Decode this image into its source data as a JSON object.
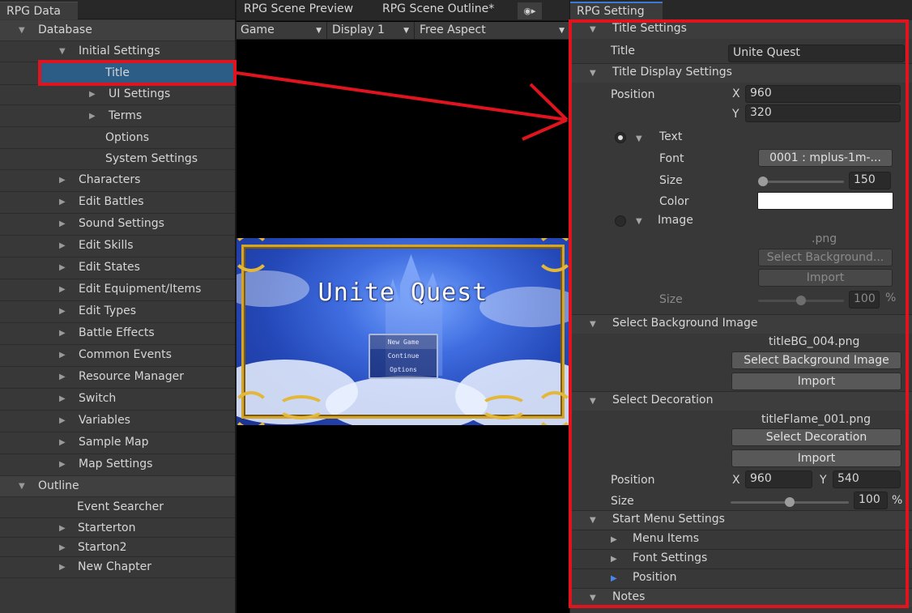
{
  "left_panel": {
    "tab": "RPG Data",
    "tree": [
      {
        "label": "Database",
        "expanded": true,
        "section": true
      },
      {
        "label": "Initial Settings",
        "expanded": true
      },
      {
        "label": "Title",
        "selected": true
      },
      {
        "label": "UI Settings",
        "expandable": true
      },
      {
        "label": "Terms",
        "expandable": true
      },
      {
        "label": "Options"
      },
      {
        "label": "System Settings"
      },
      {
        "label": "Characters",
        "expandable": true
      },
      {
        "label": "Edit Battles",
        "expandable": true
      },
      {
        "label": "Sound Settings",
        "expandable": true
      },
      {
        "label": "Edit Skills",
        "expandable": true
      },
      {
        "label": "Edit States",
        "expandable": true
      },
      {
        "label": "Edit Equipment/Items",
        "expandable": true
      },
      {
        "label": "Edit Types",
        "expandable": true
      },
      {
        "label": "Battle Effects",
        "expandable": true
      },
      {
        "label": "Common Events",
        "expandable": true
      },
      {
        "label": "Resource Manager",
        "expandable": true
      },
      {
        "label": "Switch",
        "expandable": true
      },
      {
        "label": "Variables",
        "expandable": true
      },
      {
        "label": "Sample Map",
        "expandable": true
      },
      {
        "label": "Map Settings",
        "expandable": true
      },
      {
        "label": "Outline",
        "expanded": true,
        "section": true
      },
      {
        "label": "Event Searcher"
      },
      {
        "label": "Starterton",
        "expandable": true
      },
      {
        "label": "Starton2",
        "expandable": true
      },
      {
        "label": "New Chapter",
        "expandable": true
      }
    ]
  },
  "middle_panel": {
    "tabs": [
      "RPG Scene Preview",
      "RPG Scene Outline*"
    ],
    "toolbar": {
      "display_mode": "Game",
      "display": "Display 1",
      "aspect": "Free Aspect"
    },
    "preview": {
      "game_title": "Unite Quest",
      "menu_items": [
        "New Game",
        "Continue",
        "Options"
      ]
    }
  },
  "right_panel": {
    "tab": "RPG Setting",
    "title_settings": {
      "header": "Title Settings",
      "title_label": "Title",
      "title_value": "Unite Quest"
    },
    "title_display": {
      "header": "Title Display Settings",
      "position_label": "Position",
      "x_label": "X",
      "x_value": "960",
      "y_label": "Y",
      "y_value": "320",
      "text_label": "Text",
      "font_label": "Font",
      "font_value": "0001 : mplus-1m-...",
      "size_label": "Size",
      "size_value": "150",
      "size_fraction": 0.06,
      "color_label": "Color",
      "color_value": "#ffffff",
      "image_label": "Image",
      "image_ext": ".png",
      "select_bg_btn": "Select Background...",
      "import_btn": "Import",
      "image_size_label": "Size",
      "image_size_value": "100",
      "image_size_fraction": 0.5,
      "percent": "%"
    },
    "background": {
      "header": "Select Background Image",
      "filename": "titleBG_004.png",
      "select_btn": "Select Background Image",
      "import_btn": "Import"
    },
    "decoration": {
      "header": "Select Decoration",
      "filename": "titleFlame_001.png",
      "select_btn": "Select Decoration",
      "import_btn": "Import",
      "position_label": "Position",
      "x_label": "X",
      "x_value": "960",
      "y_label": "Y",
      "y_value": "540",
      "size_label": "Size",
      "size_value": "100",
      "size_fraction": 0.5,
      "percent": "%"
    },
    "start_menu": {
      "header": "Start Menu Settings",
      "items": [
        "Menu Items",
        "Font Settings",
        "Position"
      ]
    },
    "notes": {
      "header": "Notes"
    }
  },
  "colors": {
    "highlight": "#e0141e",
    "selection": "#2c5d87",
    "accent": "#3a7bd5"
  }
}
